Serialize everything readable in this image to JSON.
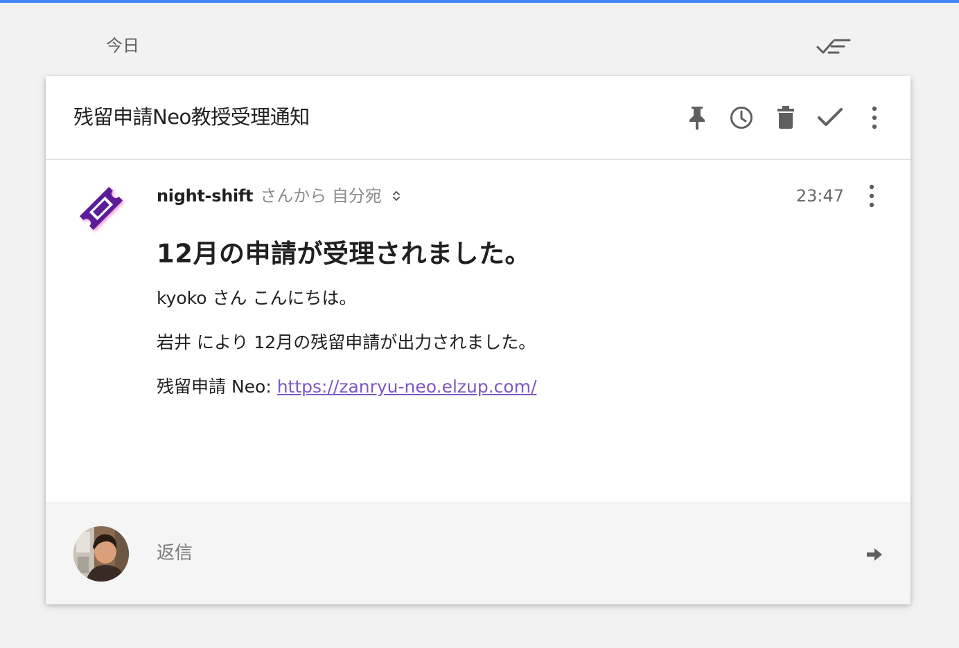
{
  "app": {
    "accent_color": "#4285f4"
  },
  "bundle": {
    "day_label": "今日",
    "sweep_icon": "sweep-done-icon"
  },
  "thread": {
    "subject": "残留申請Neo教授受理通知",
    "actions": [
      {
        "name": "pin",
        "icon": "pin-icon"
      },
      {
        "name": "snooze",
        "icon": "clock-icon"
      },
      {
        "name": "delete",
        "icon": "trash-icon"
      },
      {
        "name": "done",
        "icon": "check-icon"
      },
      {
        "name": "more",
        "icon": "more-vert-icon"
      }
    ]
  },
  "message": {
    "sender_name": "night-shift",
    "sender_meta": "さんから 自分宛",
    "time": "23:47",
    "avatar_icon": "ticket-icon",
    "heading": "12月の申請が受理されました。",
    "greeting": "kyoko さん こんにちは。",
    "line1": "岩井 により 12月の残留申請が出力されました。",
    "link_label": "残留申請 Neo: ",
    "link_url": "https://zanryu-neo.elzup.com/",
    "link_color": "#7e57c2"
  },
  "reply": {
    "placeholder": "返信",
    "send_icon": "arrow-right-icon"
  }
}
